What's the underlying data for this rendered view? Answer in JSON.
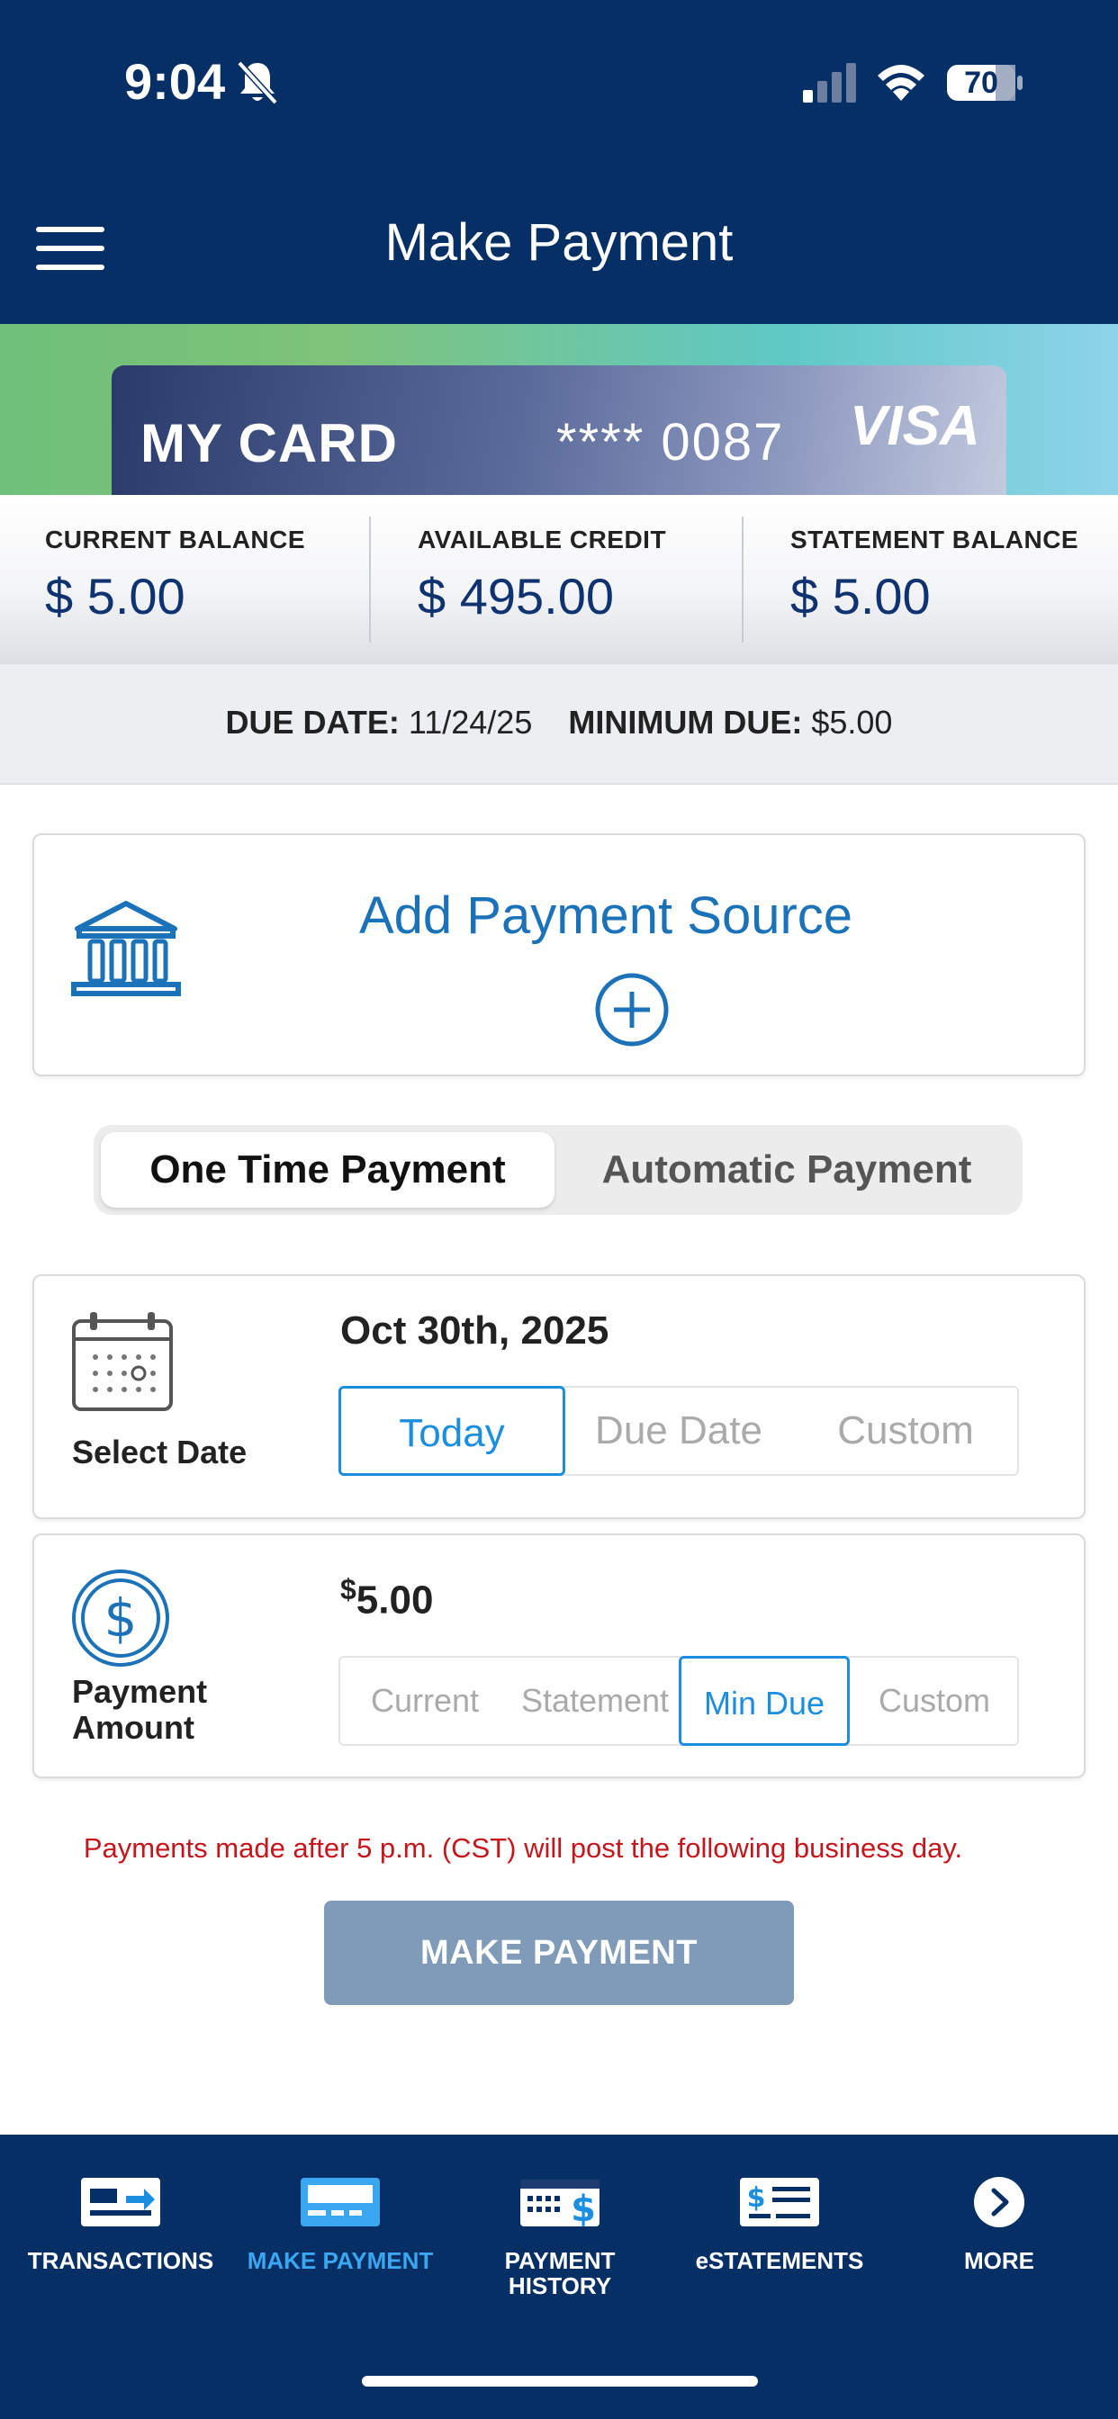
{
  "status_bar": {
    "time": "9:04",
    "battery": "70"
  },
  "header": {
    "title": "Make Payment"
  },
  "card": {
    "name": "MY CARD",
    "number": "**** 0087",
    "brand": "VISA"
  },
  "balances": [
    {
      "label": "CURRENT BALANCE",
      "value": "$ 5.00"
    },
    {
      "label": "AVAILABLE CREDIT",
      "value": "$ 495.00"
    },
    {
      "label": "STATEMENT BALANCE",
      "value": "$ 5.00"
    }
  ],
  "due": {
    "due_date_label": "DUE DATE:",
    "due_date": "11/24/25",
    "min_due_label": "MINIMUM DUE:",
    "min_due": "$5.00"
  },
  "payment_source": {
    "label": "Add Payment Source"
  },
  "payment_type": {
    "options": [
      "One Time Payment",
      "Automatic Payment"
    ],
    "selected": "One Time Payment"
  },
  "date_select": {
    "label": "Select Date",
    "value": "Oct 30th, 2025",
    "options": [
      "Today",
      "Due Date",
      "Custom"
    ],
    "selected": "Today"
  },
  "amount_select": {
    "label_line1": "Payment",
    "label_line2": "Amount",
    "currency": "$",
    "value": "5.00",
    "options": [
      "Current",
      "Statement",
      "Min Due",
      "Custom"
    ],
    "selected": "Min Due"
  },
  "notice": "Payments made after 5 p.m. (CST) will post the following business day.",
  "make_payment_button": "MAKE PAYMENT",
  "bottom_nav": [
    {
      "label": "TRANSACTIONS",
      "icon": "transactions-icon"
    },
    {
      "label": "MAKE PAYMENT",
      "icon": "make-payment-icon",
      "active": true
    },
    {
      "label_line1": "PAYMENT",
      "label_line2": "HISTORY",
      "icon": "payment-history-icon"
    },
    {
      "label": "eSTATEMENTS",
      "icon": "estatements-icon"
    },
    {
      "label": "MORE",
      "icon": "more-icon"
    }
  ],
  "colors": {
    "header_bg": "#062f66",
    "accent_blue": "#1b72b8",
    "active_blue": "#1b8ee0",
    "notice_red": "#c4161c",
    "button_disabled": "#7f9bb8"
  }
}
